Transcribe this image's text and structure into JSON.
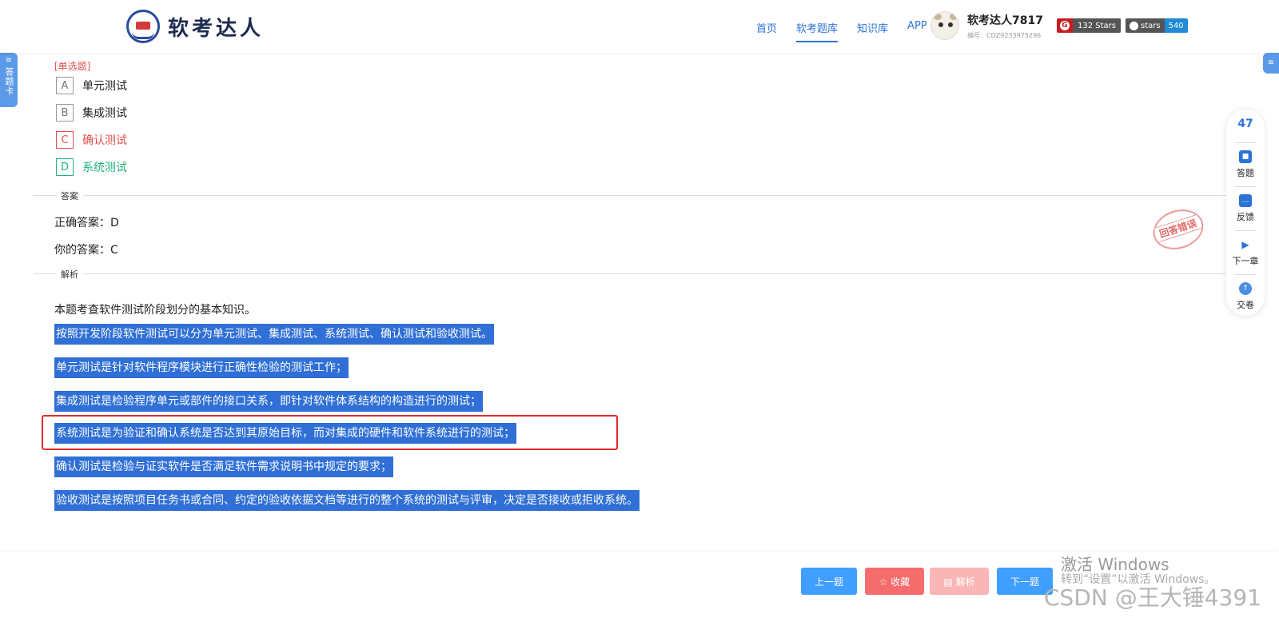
{
  "header": {
    "logo_text": "软考达人",
    "nav": [
      {
        "label": "首页",
        "active": false
      },
      {
        "label": "软考题库",
        "active": true
      },
      {
        "label": "知识库",
        "active": false
      },
      {
        "label": "APP",
        "active": false
      }
    ],
    "user": {
      "name": "软考达人7817",
      "id_label": "编号：CDZ9233975296"
    },
    "badges": {
      "gitee": {
        "icon": "G",
        "label": "132 Stars"
      },
      "github": {
        "label": "stars",
        "count": "540"
      }
    }
  },
  "left_tab": {
    "icon": "≡",
    "label": "答题卡"
  },
  "right_tab": {
    "icon": "≡"
  },
  "question": {
    "type_label": "[单选题]",
    "options": [
      {
        "letter": "A",
        "text": "单元测试"
      },
      {
        "letter": "B",
        "text": "集成测试"
      },
      {
        "letter": "C",
        "text": "确认测试"
      },
      {
        "letter": "D",
        "text": "系统测试"
      }
    ]
  },
  "answer_section": {
    "label": "答案",
    "correct": "正确答案：D",
    "yours": "你的答案：C",
    "stamp": "回答错误"
  },
  "analysis_section": {
    "label": "解析",
    "intro": "本题考查软件测试阶段划分的基本知识。",
    "highlighted": [
      "按照开发阶段软件测试可以分为单元测试、集成测试、系统测试、确认测试和验收测试。",
      "单元测试是针对软件程序模块进行正确性检验的测试工作；",
      "集成测试是检验程序单元或部件的接口关系，即针对软件体系结构的构造进行的测试；",
      "系统测试是为验证和确认系统是否达到其原始目标，而对集成的硬件和软件系统进行的测试；",
      "确认测试是检验与证实软件是否满足软件需求说明书中规定的要求；",
      "验收测试是按照项目任务书或合同、约定的验收依据文档等进行的整个系统的测试与评审，决定是否接收或拒收系统。"
    ]
  },
  "float_panel": {
    "count": "47",
    "items": [
      {
        "icon": "■",
        "label": "答题"
      },
      {
        "icon": "…",
        "label": "反馈"
      },
      {
        "icon": "▶",
        "label": "下一章"
      },
      {
        "icon": "↑",
        "label": "交卷"
      }
    ]
  },
  "bottom_bar": {
    "prev": "上一题",
    "fav": "☆ 收藏",
    "analysis": "▤ 解析",
    "next": "下一题"
  },
  "watermarks": {
    "activate_title": "激活 Windows",
    "activate_sub": "转到“设置”以激活 Windows。",
    "csdn": "CSDN @王大锤4391"
  },
  "colors": {
    "accent": "#2b74d8",
    "highlight": "#2f6fd6",
    "wrong": "#e0504f",
    "right": "#22b37a",
    "box": "#e12c2c"
  }
}
